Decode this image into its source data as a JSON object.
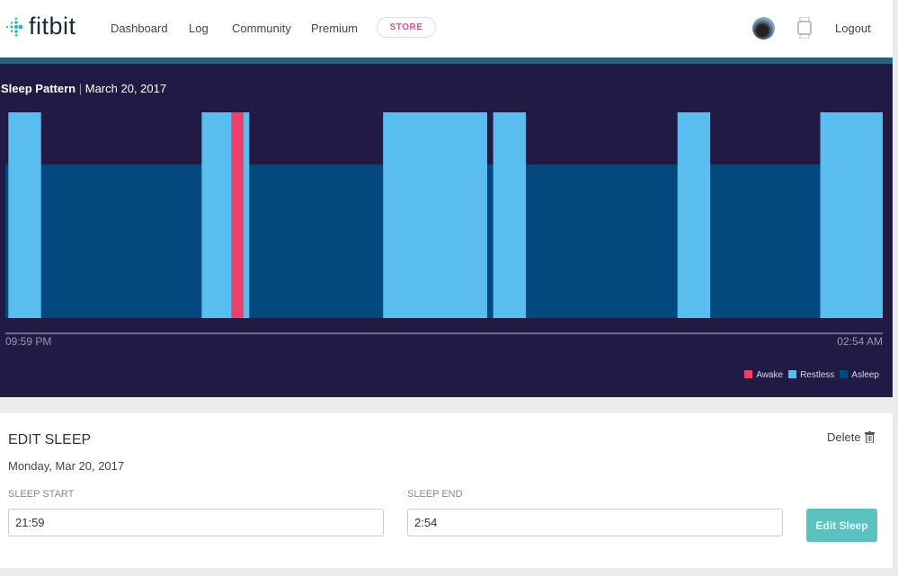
{
  "header": {
    "logo": "fitbit",
    "nav": [
      "Dashboard",
      "Log",
      "Community",
      "Premium"
    ],
    "store": "STORE",
    "logout": "Logout",
    "icons": [
      "avatar",
      "watch-icon"
    ]
  },
  "chart": {
    "title": "Sleep Pattern",
    "date": "March 20, 2017"
  },
  "chart_data": {
    "type": "timeline",
    "start": "21:59",
    "end": "02:54",
    "x_tick_labels": [
      "09:59 PM",
      "02:54 AM"
    ],
    "baseline_stage": "asleep",
    "segments": [
      {
        "stage": "restless",
        "start": "22:00",
        "end": "22:11"
      },
      {
        "stage": "restless",
        "start": "23:05",
        "end": "23:15"
      },
      {
        "stage": "awake",
        "start": "23:15",
        "end": "23:19"
      },
      {
        "stage": "restless",
        "start": "23:19",
        "end": "23:21"
      },
      {
        "stage": "restless",
        "start": "00:06",
        "end": "00:41"
      },
      {
        "stage": "restless",
        "start": "00:43",
        "end": "00:54"
      },
      {
        "stage": "restless",
        "start": "01:45",
        "end": "01:56"
      },
      {
        "stage": "restless",
        "start": "02:33",
        "end": "02:54"
      }
    ],
    "legend": [
      {
        "name": "Awake",
        "color": "#e8416b"
      },
      {
        "name": "Restless",
        "color": "#5abdf0"
      },
      {
        "name": "Asleep",
        "color": "#03497d"
      }
    ],
    "legend_position": "bottom-right"
  },
  "edit": {
    "title": "EDIT SLEEP",
    "date": "Monday, Mar 20, 2017",
    "delete": "Delete",
    "start_label": "SLEEP START",
    "start_value": "21:59",
    "end_label": "SLEEP END",
    "end_value": "2:54",
    "button": "Edit Sleep"
  }
}
